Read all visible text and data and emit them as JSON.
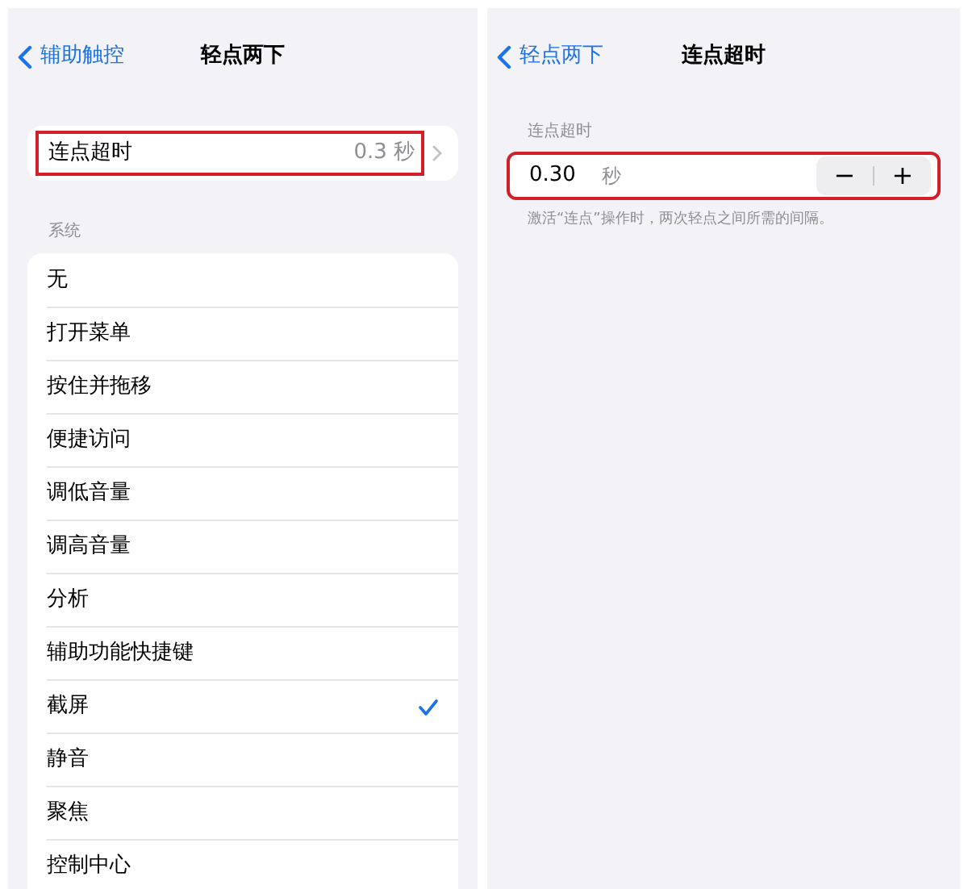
{
  "left_screen": {
    "nav": {
      "back": "辅助触控",
      "title": "轻点两下"
    },
    "timeout_row": {
      "label": "连点超时",
      "value": "0.3 秒",
      "highlighted": true
    },
    "section_header": "系统",
    "actions": [
      {
        "label": "无",
        "selected": false
      },
      {
        "label": "打开菜单",
        "selected": false
      },
      {
        "label": "按住并拖移",
        "selected": false
      },
      {
        "label": "便捷访问",
        "selected": false
      },
      {
        "label": "调低音量",
        "selected": false
      },
      {
        "label": "调高音量",
        "selected": false
      },
      {
        "label": "分析",
        "selected": false
      },
      {
        "label": "辅助功能快捷键",
        "selected": false
      },
      {
        "label": "截屏",
        "selected": true
      },
      {
        "label": "静音",
        "selected": false
      },
      {
        "label": "聚焦",
        "selected": false
      },
      {
        "label": "控制中心",
        "selected": false
      }
    ]
  },
  "right_screen": {
    "nav": {
      "back": "轻点两下",
      "title": "连点超时"
    },
    "section_header": "连点超时",
    "stepper_row": {
      "value": "0.30",
      "unit": "秒",
      "minus": "−",
      "plus": "+",
      "highlighted": true
    },
    "footer": "激活“连点”操作时，两次轻点之间所需的间隔。"
  }
}
